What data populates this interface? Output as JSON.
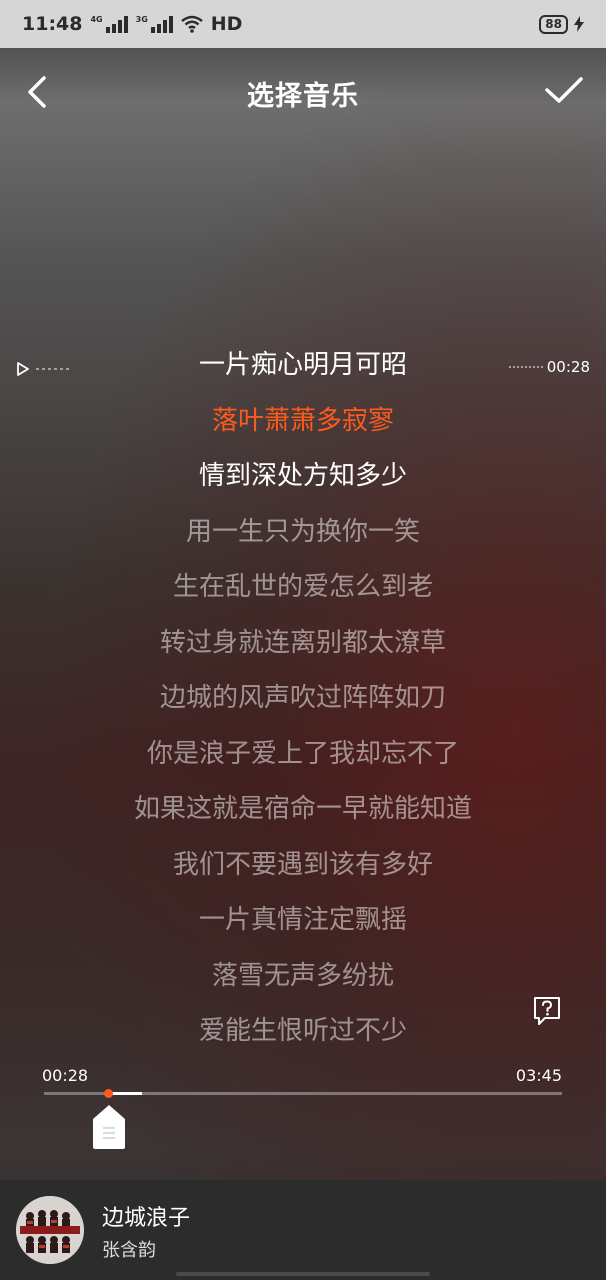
{
  "status_bar": {
    "time": "11:48",
    "signal1_label": "4G",
    "signal2_label": "3G",
    "network_label": "HD",
    "battery": "88"
  },
  "header": {
    "title": "选择音乐"
  },
  "current_position": "00:28",
  "lyrics": [
    {
      "text": "一片痴心明月可昭",
      "state": "bright"
    },
    {
      "text": "落叶萧萧多寂寥",
      "state": "active"
    },
    {
      "text": "情到深处方知多少",
      "state": "bright"
    },
    {
      "text": "用一生只为换你一笑",
      "state": "dim"
    },
    {
      "text": "生在乱世的爱怎么到老",
      "state": "dim"
    },
    {
      "text": "转过身就连离别都太潦草",
      "state": "dim"
    },
    {
      "text": "边城的风声吹过阵阵如刀",
      "state": "dim"
    },
    {
      "text": "你是浪子爱上了我却忘不了",
      "state": "dim"
    },
    {
      "text": "如果这就是宿命一早就能知道",
      "state": "dim"
    },
    {
      "text": "我们不要遇到该有多好",
      "state": "dim"
    },
    {
      "text": "一片真情注定飘摇",
      "state": "dim"
    },
    {
      "text": "落雪无声多纷扰",
      "state": "dim"
    },
    {
      "text": "爱能生恨听过不少",
      "state": "dim"
    }
  ],
  "progress": {
    "current_time": "00:28",
    "total_time": "03:45",
    "position_fraction": 0.124,
    "selection_start_fraction": 0.124,
    "selection_end_fraction": 0.19
  },
  "now_playing": {
    "title": "边城浪子",
    "artist": "张含韵"
  },
  "colors": {
    "accent": "#ff5a1e",
    "bottom_bar": "#2c2c2c"
  },
  "icons": {
    "back": "chevron-left-icon",
    "confirm": "check-icon",
    "play": "play-triangle-icon",
    "help": "question-bubble-icon",
    "handle": "drag-handle-icon"
  }
}
